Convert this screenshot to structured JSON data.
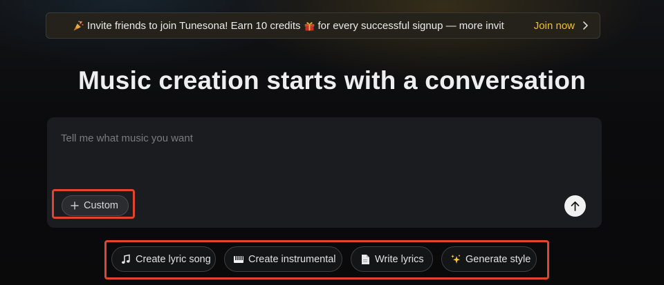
{
  "banner": {
    "message": "Invite friends to join Tunesona! Earn 10 credits",
    "message_tail": "for every successful signup — more invit",
    "join_label": "Join now",
    "icons": [
      "party-popper-icon",
      "gift-icon",
      "chevron-right-icon"
    ]
  },
  "hero": {
    "title": "Music creation starts with a conversation"
  },
  "composer": {
    "placeholder": "Tell me what music you want",
    "custom_label": "Custom",
    "send_icon": "arrow-up-icon"
  },
  "suggestions": [
    {
      "label": "Create lyric song",
      "icon": "music-note-icon"
    },
    {
      "label": "Create instrumental",
      "icon": "piano-icon"
    },
    {
      "label": "Write lyrics",
      "icon": "document-icon"
    },
    {
      "label": "Generate style",
      "icon": "sparkles-icon"
    }
  ],
  "colors": {
    "accent": "#f2c12e",
    "highlight": "#e2442e",
    "background": "#0c0c0e",
    "composer_bg": "#1b1c1f"
  }
}
